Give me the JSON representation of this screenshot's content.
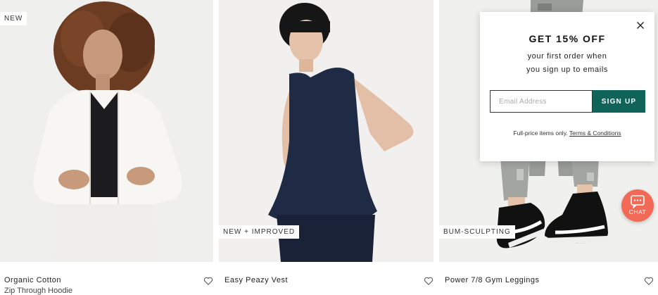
{
  "products": [
    {
      "name": "Organic Cotton",
      "subtitle": "Zip Through Hoodie",
      "badge": "NEW",
      "image": "model-white-hoodie"
    },
    {
      "name": "Easy Peazy Vest",
      "subtitle": "",
      "badge": "NEW + IMPROVED",
      "image": "model-navy-vest"
    },
    {
      "name": "Power 7/8 Gym Leggings",
      "subtitle": "",
      "badge": "BUM-SCULPTING",
      "image": "legs-camo-leggings"
    }
  ],
  "popup": {
    "title": "GET 15% OFF",
    "line1": "your first order when",
    "line2": "you sign up to emails",
    "email_placeholder": "Email Address",
    "signup_label": "SIGN UP",
    "fine_print": "Full-price items only.",
    "terms_link": "Terms & Conditions"
  },
  "chat": {
    "label": "CHAT"
  },
  "colors": {
    "accent": "#0f6359",
    "chat": "#f26a55"
  },
  "icons": [
    "heart-icon",
    "close-icon",
    "chat-bubble-icon"
  ]
}
